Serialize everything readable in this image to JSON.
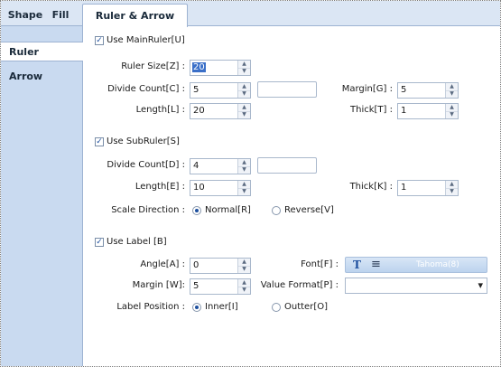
{
  "tabs": [
    "Shape",
    "Fill",
    "Ruler & Arrow"
  ],
  "sidebar": [
    "Ruler",
    "Arrow"
  ],
  "main_ruler": {
    "check_label": "Use MainRuler[U]",
    "size_label": "Ruler Size[Z] :",
    "size_value": "20",
    "divide_label": "Divide Count[C] :",
    "divide_value": "5",
    "margin_label": "Margin[G] :",
    "margin_value": "5",
    "length_label": "Length[L] :",
    "length_value": "20",
    "thick_label": "Thick[T] :",
    "thick_value": "1"
  },
  "sub_ruler": {
    "check_label": "Use SubRuler[S]",
    "divide_label": "Divide Count[D] :",
    "divide_value": "4",
    "length_label": "Length[E] :",
    "length_value": "10",
    "thick_label": "Thick[K] :",
    "thick_value": "1",
    "scale_label": "Scale Direction :",
    "normal_label": "Normal[R]",
    "reverse_label": "Reverse[V]"
  },
  "label": {
    "check_label": "Use Label [B]",
    "angle_label": "Angle[A] :",
    "angle_value": "0",
    "font_label": "Font[F] :",
    "font_value": "Tahoma(8)",
    "margin_label": "Margin [W]:",
    "margin_value": "5",
    "format_label": "Value Format[P] :",
    "position_label": "Label Position :",
    "inner_label": "Inner[I]",
    "outter_label": "Outter[O]"
  },
  "glyphs": {
    "check": "✓",
    "up": "▲",
    "down": "▼",
    "font_t": "T",
    "font_align": "≡",
    "caret": "▾"
  },
  "colors": {
    "accent": "#1d4f9e",
    "tab_bg": "#dbe6f4",
    "sidebar_bg": "#c9daf0",
    "selection": "#3a6fc8"
  }
}
